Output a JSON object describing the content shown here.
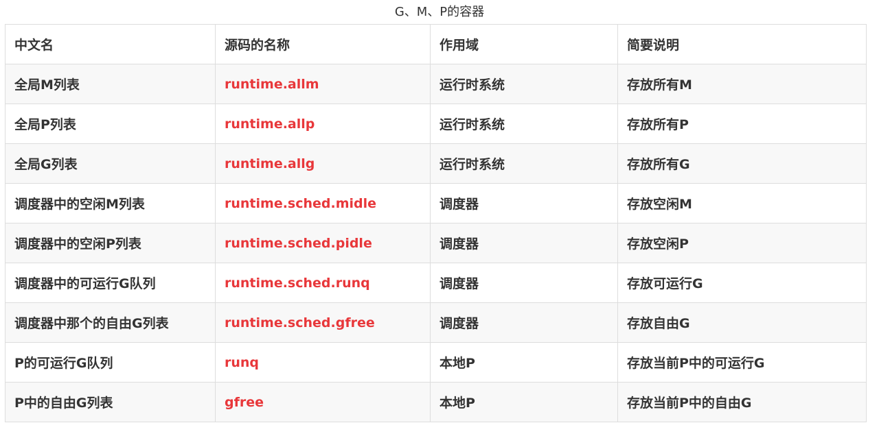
{
  "caption": "G、M、P的容器",
  "columns": [
    "中文名",
    "源码的名称",
    "作用域",
    "简要说明"
  ],
  "rows": [
    [
      "全局M列表",
      "runtime.allm",
      "运行时系统",
      "存放所有M"
    ],
    [
      "全局P列表",
      "runtime.allp",
      "运行时系统",
      "存放所有P"
    ],
    [
      "全局G列表",
      "runtime.allg",
      "运行时系统",
      "存放所有G"
    ],
    [
      "调度器中的空闲M列表",
      "runtime.sched.midle",
      "调度器",
      "存放空闲M"
    ],
    [
      "调度器中的空闲P列表",
      "runtime.sched.pidle",
      "调度器",
      "存放空闲P"
    ],
    [
      "调度器中的可运行G队列",
      "runtime.sched.runq",
      "调度器",
      "存放可运行G"
    ],
    [
      "调度器中那个的自由G列表",
      "runtime.sched.gfree",
      "调度器",
      "存放自由G"
    ],
    [
      "P的可运行G队列",
      "runq",
      "本地P",
      "存放当前P中的可运行G"
    ],
    [
      "P中的自由G列表",
      "gfree",
      "本地P",
      "存放当前P中的自由G"
    ]
  ],
  "colors": {
    "code_text": "#e8373a",
    "border": "#dddddd",
    "stripe": "#f8f8f8"
  }
}
